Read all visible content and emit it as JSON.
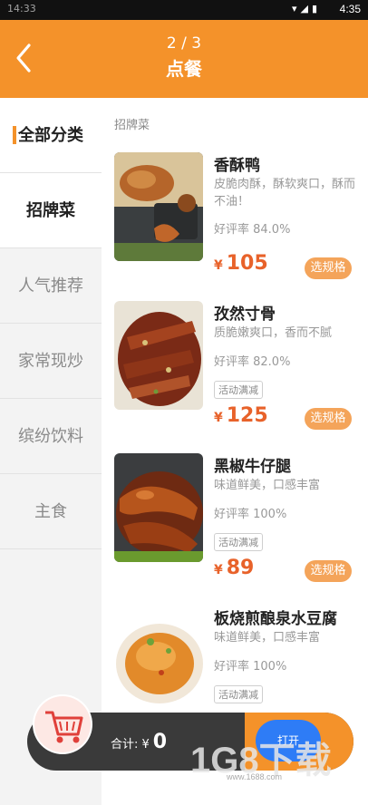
{
  "status": {
    "time": "4:35",
    "left_time": "14:33"
  },
  "header": {
    "back_glyph": "<",
    "counter": "2 / 3",
    "title": "点餐"
  },
  "sidebar": {
    "categories": [
      "全部分类",
      "招牌菜",
      "人气推荐",
      "家常现炒",
      "缤纷饮料",
      "主食"
    ]
  },
  "main": {
    "section_title": "招牌菜",
    "dishes": [
      {
        "name": "香酥鸭",
        "desc": "皮脆肉酥，酥软爽口，酥而不油！",
        "rating": "好评率 84.0%",
        "promo": "",
        "price": "105",
        "currency": "¥",
        "spec": "选规格"
      },
      {
        "name": "孜然寸骨",
        "desc": "质脆嫩爽口，香而不腻",
        "rating": "好评率 82.0%",
        "promo": "活动满减",
        "price": "125",
        "currency": "¥",
        "spec": "选规格"
      },
      {
        "name": "黑椒牛仔腿",
        "desc": "味道鲜美，口感丰富",
        "rating": "好评率 100%",
        "promo": "活动满减",
        "price": "89",
        "currency": "¥",
        "spec": "选规格"
      },
      {
        "name": "板烧煎酿泉水豆腐",
        "desc": "味道鲜美，口感丰富",
        "rating": "好评率 100%",
        "promo": "活动满减",
        "price": "",
        "currency": "",
        "spec": ""
      }
    ]
  },
  "cart": {
    "total_label": "合计: ¥",
    "total_value": "0",
    "open_label": "打开"
  },
  "watermark": {
    "text": "1G8下载",
    "url": "www.1688.com"
  },
  "colors": {
    "accent": "#f4922a",
    "price": "#e8622a"
  }
}
